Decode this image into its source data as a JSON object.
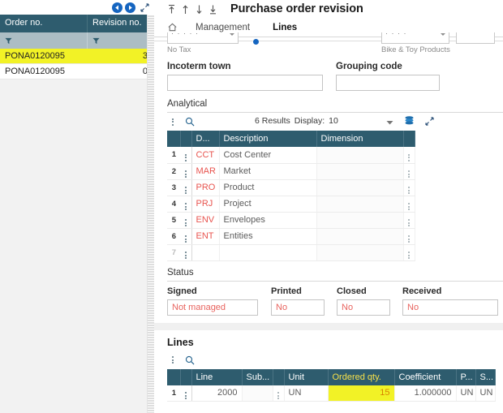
{
  "left_panel": {
    "nav": {
      "prev_icon": "circle-left-arrow-icon",
      "next_icon": "circle-right-arrow-icon",
      "expand_icon": "expand-diagonal-icon"
    },
    "columns": [
      "Order no.",
      "Revision no."
    ],
    "filter_icon": "funnel-icon",
    "rows": [
      {
        "order_no": "PONA0120095",
        "revision_no": "3",
        "selected": true
      },
      {
        "order_no": "PONA0120095",
        "revision_no": "0",
        "selected": false
      }
    ],
    "collapse_icon": "collapse-left-arrow-icon"
  },
  "header": {
    "icons": [
      "go-to-first-icon",
      "go-to-previous-icon",
      "go-to-next-icon",
      "go-to-last-icon"
    ],
    "title": "Purchase order revision"
  },
  "tabs": {
    "home_icon": "home-icon",
    "items": [
      {
        "label": "Management",
        "active": false
      },
      {
        "label": "Lines",
        "active": true
      }
    ]
  },
  "cut_fields": {
    "tax_helper": "No Tax",
    "product_helper": "Bike & Toy Products"
  },
  "form": {
    "incoterm_town": {
      "label": "Incoterm town",
      "value": "",
      "placeholder": ""
    },
    "grouping_code": {
      "label": "Grouping code",
      "value": "",
      "placeholder": ""
    }
  },
  "analytical": {
    "title": "Analytical",
    "toolbar": {
      "menu_icon": "kebab-menu-icon",
      "search_icon": "search-icon",
      "results_count": "6 Results",
      "display_label": "Display:",
      "display_value": "10",
      "caret_icon": "chevron-down-icon",
      "layers_icon": "layers-stack-icon",
      "expand_icon": "expand-diagonal-icon"
    },
    "columns": [
      "D...",
      "Description",
      "Dimension"
    ],
    "rows": [
      {
        "index": "1",
        "code": "CCT",
        "description": "Cost Center",
        "dimension": ""
      },
      {
        "index": "2",
        "code": "MAR",
        "description": "Market",
        "dimension": ""
      },
      {
        "index": "3",
        "code": "PRO",
        "description": "Product",
        "dimension": ""
      },
      {
        "index": "4",
        "code": "PRJ",
        "description": "Project",
        "dimension": ""
      },
      {
        "index": "5",
        "code": "ENV",
        "description": "Envelopes",
        "dimension": ""
      },
      {
        "index": "6",
        "code": "ENT",
        "description": "Entities",
        "dimension": ""
      },
      {
        "index": "7",
        "code": "",
        "description": "",
        "dimension": ""
      }
    ],
    "row_menu_icon": "kebab-menu-icon",
    "row_grip_icon": "drag-grip-icon"
  },
  "status": {
    "title": "Status",
    "fields": [
      {
        "label": "Signed",
        "value": "Not managed"
      },
      {
        "label": "Printed",
        "value": "No"
      },
      {
        "label": "Closed",
        "value": "No"
      },
      {
        "label": "Received",
        "value": "No"
      }
    ]
  },
  "lines": {
    "title": "Lines",
    "toolbar": {
      "menu_icon": "kebab-menu-icon",
      "search_icon": "search-icon"
    },
    "columns": [
      "Line",
      "Sub...",
      "Unit",
      "Ordered qty.",
      "Coefficient",
      "P...",
      "S..."
    ],
    "highlighted_column": "Ordered qty.",
    "rows": [
      {
        "index": "1",
        "line": "2000",
        "sub": "",
        "unit": "UN",
        "ordered_qty": "15",
        "coefficient": "1.000000",
        "p": "UN",
        "s": "UN"
      }
    ]
  },
  "colors": {
    "header_teal": "#2e5c6e",
    "filter_teal": "#acbdc4",
    "highlight_yellow": "#f2f226",
    "accent_blue": "#1565c0",
    "code_red": "#e8544f",
    "status_red": "#e8635e",
    "qty_orange": "#d98400"
  }
}
